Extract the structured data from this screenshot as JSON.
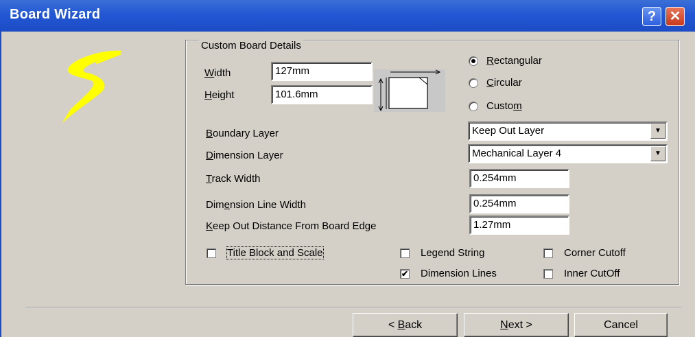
{
  "window": {
    "title": "Board Wizard",
    "help_label": "?",
    "close_label": "✕"
  },
  "group": {
    "title": "Custom Board Details"
  },
  "fields": {
    "width_label": "Width",
    "width_value": "127mm",
    "height_label": "Height",
    "height_value": "101.6mm",
    "boundary_label": "Boundary Layer",
    "boundary_value": "Keep Out Layer",
    "dimension_label": "Dimension Layer",
    "dimension_value": "Mechanical Layer 4",
    "track_label": "Track Width",
    "track_value": "0.254mm",
    "dimline_label": "Dimension Line Width",
    "dimline_value": "0.254mm",
    "keepout_label": "Keep Out Distance From Board Edge",
    "keepout_value": "1.27mm"
  },
  "shape_options": [
    {
      "label": "Rectangular",
      "selected": true
    },
    {
      "label": "Circular",
      "selected": false
    },
    {
      "label": "Custom",
      "selected": false
    }
  ],
  "checkboxes": {
    "title_block": {
      "label": "Title Block and Scale",
      "checked": false
    },
    "legend_string": {
      "label": "Legend String",
      "checked": false
    },
    "corner_cutoff": {
      "label": "Corner Cutoff",
      "checked": false
    },
    "dimension_lines": {
      "label": "Dimension Lines",
      "checked": true
    },
    "inner_cutoff": {
      "label": "Inner CutOff",
      "checked": false
    }
  },
  "buttons": {
    "back": "< Back",
    "next": "Next >",
    "cancel": "Cancel"
  },
  "icons": {
    "logo": "yellow-lightning-logo",
    "board": "board-dimension-icon",
    "dropdown": "chevron-down-icon"
  }
}
